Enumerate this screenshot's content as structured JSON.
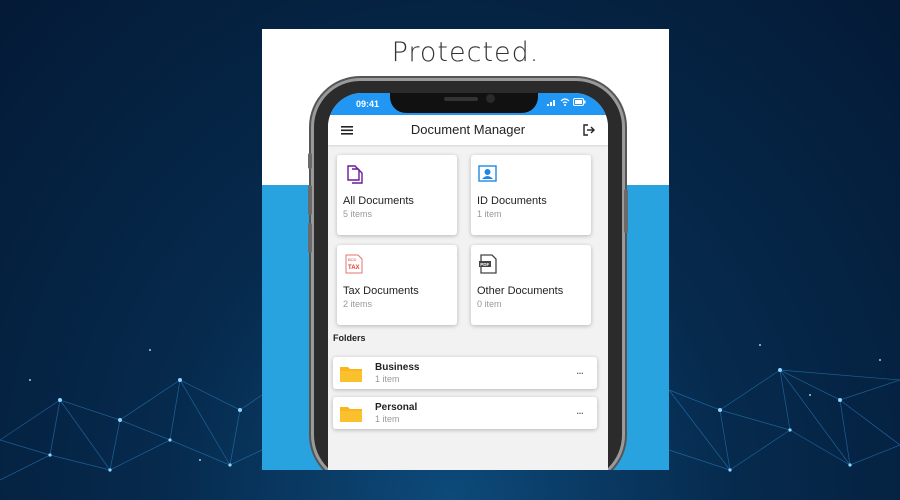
{
  "tagline": "Protected.",
  "status_bar": {
    "time": "09:41",
    "icons": [
      "signal-icon",
      "wifi-icon",
      "battery-icon"
    ]
  },
  "app_bar": {
    "title": "Document Manager",
    "menu_icon": "hamburger-menu-icon",
    "logout_icon": "logout-icon"
  },
  "categories": [
    {
      "label": "All Documents",
      "count": "5 items",
      "icon": "documents-icon",
      "color": "#6a1b9a"
    },
    {
      "label": "ID Documents",
      "count": "1 item",
      "icon": "id-card-icon",
      "color": "#1e88e5"
    },
    {
      "label": "Tax Documents",
      "count": "2 items",
      "icon": "tax-document-icon",
      "color": "#e53935"
    },
    {
      "label": "Other Documents",
      "count": "0 item",
      "icon": "pdf-document-icon",
      "color": "#555555"
    }
  ],
  "folders_section": {
    "title": "Folders",
    "items": [
      {
        "name": "Business",
        "count": "1 item",
        "icon": "folder-icon",
        "menu": "..."
      },
      {
        "name": "Personal",
        "count": "1 item",
        "icon": "folder-icon",
        "menu": "..."
      }
    ]
  },
  "colors": {
    "status_bar": "#2196f3",
    "band": "#29a3e0",
    "folder": "#f9b51a"
  },
  "tax_badge": {
    "top": "BCD",
    "main": "TAX"
  },
  "pdf_badge": "PDF"
}
